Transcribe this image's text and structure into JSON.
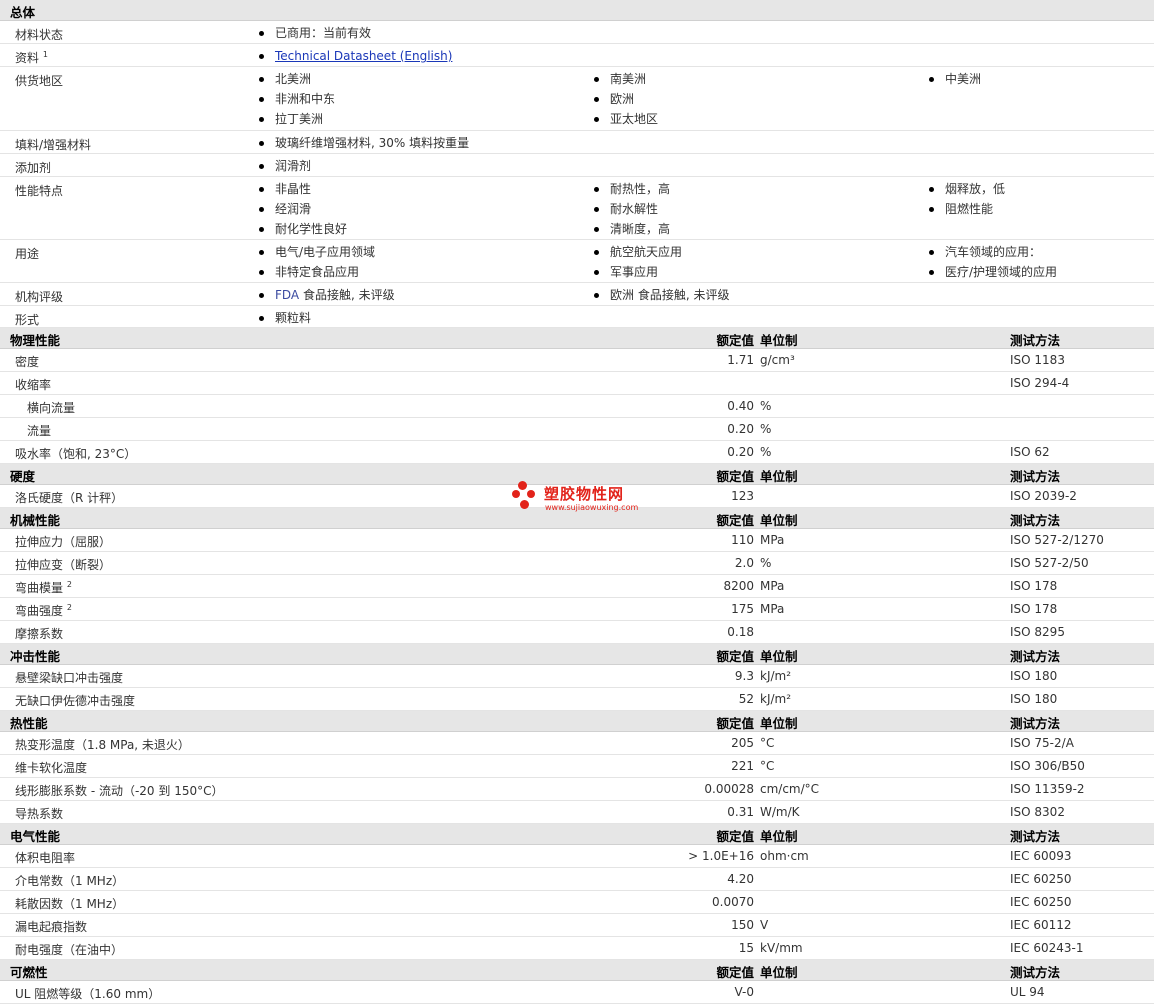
{
  "general": {
    "title": "总体",
    "rows": [
      {
        "label": "材料状态",
        "c1": [
          "已商用：当前有效"
        ],
        "c2": [],
        "c3": []
      },
      {
        "label": "资料",
        "sup": "1",
        "c1": [
          "Technical Datasheet (English)"
        ],
        "c2": [],
        "c3": []
      },
      {
        "label": "供货地区",
        "c1": [
          "北美洲",
          "非洲和中东",
          "拉丁美洲"
        ],
        "c2": [
          "南美洲",
          "欧洲",
          "亚太地区"
        ],
        "c3": [
          "中美洲"
        ]
      },
      {
        "label": "填料/增强材料",
        "c1": [
          "玻璃纤维增强材料, 30% 填料按重量"
        ],
        "c2": [],
        "c3": []
      },
      {
        "label": "添加剂",
        "c1": [
          "润滑剂"
        ],
        "c2": [],
        "c3": []
      },
      {
        "label": "性能特点",
        "c1": [
          "非晶性",
          "经润滑",
          "耐化学性良好"
        ],
        "c2": [
          "耐热性，高",
          "耐水解性",
          "清晰度，高"
        ],
        "c3": [
          "烟释放，低",
          "阻燃性能"
        ]
      },
      {
        "label": "用途",
        "c1": [
          "电气/电子应用领域",
          "非特定食品应用"
        ],
        "c2": [
          "航空航天应用",
          "军事应用"
        ],
        "c3": [
          "汽车领域的应用：",
          "医疗/护理领域的应用"
        ]
      },
      {
        "label": "机构评级",
        "c1": [
          "FDA 食品接触, 未评级"
        ],
        "c2": [
          "欧洲 食品接触, 未评级"
        ],
        "c3": []
      },
      {
        "label": "形式",
        "c1": [
          "颗粒料"
        ],
        "c2": [],
        "c3": []
      }
    ]
  },
  "headers": {
    "value": "额定值",
    "unit": "单位制",
    "test": "测试方法"
  },
  "sections": [
    {
      "title": "物理性能",
      "rows": [
        {
          "label": "密度",
          "value": "1.71",
          "unit": "g/cm³",
          "test": "ISO 1183"
        },
        {
          "label": "收缩率",
          "value": "",
          "unit": "",
          "test": "ISO 294-4"
        },
        {
          "label": "横向流量",
          "indent": true,
          "value": "0.40",
          "unit": "%",
          "test": ""
        },
        {
          "label": "流量",
          "indent": true,
          "value": "0.20",
          "unit": "%",
          "test": ""
        },
        {
          "label": "吸水率（饱和, 23°C）",
          "value": "0.20",
          "unit": "%",
          "test": "ISO 62"
        }
      ]
    },
    {
      "title": "硬度",
      "rows": [
        {
          "label": "洛氏硬度（R 计秤）",
          "value": "123",
          "unit": "",
          "test": "ISO 2039-2"
        }
      ]
    },
    {
      "title": "机械性能",
      "rows": [
        {
          "label": "拉伸应力（屈服）",
          "value": "110",
          "unit": "MPa",
          "test": "ISO 527-2/1270"
        },
        {
          "label": "拉伸应变（断裂）",
          "value": "2.0",
          "unit": "%",
          "test": "ISO 527-2/50"
        },
        {
          "label": "弯曲模量",
          "sup": "2",
          "value": "8200",
          "unit": "MPa",
          "test": "ISO 178"
        },
        {
          "label": "弯曲强度",
          "sup": "2",
          "value": "175",
          "unit": "MPa",
          "test": "ISO 178"
        },
        {
          "label": "摩擦系数",
          "value": "0.18",
          "unit": "",
          "test": "ISO 8295"
        }
      ]
    },
    {
      "title": "冲击性能",
      "rows": [
        {
          "label": "悬壁梁缺口冲击强度",
          "value": "9.3",
          "unit": "kJ/m²",
          "test": "ISO 180"
        },
        {
          "label": "无缺口伊佐德冲击强度",
          "value": "52",
          "unit": "kJ/m²",
          "test": "ISO 180"
        }
      ]
    },
    {
      "title": "热性能",
      "rows": [
        {
          "label": "热变形温度（1.8 MPa, 未退火）",
          "value": "205",
          "unit": "°C",
          "test": "ISO 75-2/A"
        },
        {
          "label": "维卡软化温度",
          "value": "221",
          "unit": "°C",
          "test": "ISO 306/B50"
        },
        {
          "label": "线形膨胀系数 - 流动（-20 到 150°C）",
          "value": "0.00028",
          "unit": "cm/cm/°C",
          "test": "ISO 11359-2"
        },
        {
          "label": "导热系数",
          "value": "0.31",
          "unit": "W/m/K",
          "test": "ISO 8302"
        }
      ]
    },
    {
      "title": "电气性能",
      "rows": [
        {
          "label": "体积电阻率",
          "value": "> 1.0E+16",
          "unit": "ohm·cm",
          "test": "IEC 60093"
        },
        {
          "label": "介电常数（1 MHz）",
          "value": "4.20",
          "unit": "",
          "test": "IEC 60250"
        },
        {
          "label": "耗散因数（1 MHz）",
          "value": "0.0070",
          "unit": "",
          "test": "IEC 60250"
        },
        {
          "label": "漏电起痕指数",
          "value": "150",
          "unit": "V",
          "test": "IEC 60112"
        },
        {
          "label": "耐电强度（在油中）",
          "value": "15",
          "unit": "kV/mm",
          "test": "IEC 60243-1"
        }
      ]
    },
    {
      "title": "可燃性",
      "rows": [
        {
          "label": "UL 阻燃等级（1.60 mm）",
          "value": "V-0",
          "unit": "",
          "test": "UL 94"
        }
      ]
    }
  ],
  "watermark": {
    "name": "塑胶物性网",
    "url": "www.sujiaowuxing.com"
  }
}
